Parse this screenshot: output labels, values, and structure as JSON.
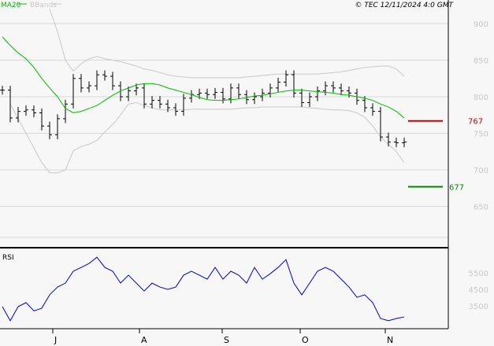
{
  "header": {
    "ma_label": "MA20",
    "bb_label": "BBands",
    "copyright": "© TEC 12/11/2024 4:0 GMT"
  },
  "colors": {
    "ma": "#00bb00",
    "bb": "#c8c8c8",
    "rsi": "#0000cc",
    "resistance": "#cc0000",
    "support": "#008800",
    "grid": "#d8d8d8"
  },
  "chart_data": [
    {
      "type": "ohlc",
      "title": "Price",
      "ylim": [
        620,
        930
      ],
      "yticks": [
        650,
        700,
        750,
        800,
        850,
        900
      ],
      "closes": [
        809,
        771,
        780,
        782,
        778,
        760,
        748,
        770,
        790,
        825,
        812,
        815,
        830,
        828,
        815,
        800,
        808,
        812,
        790,
        795,
        790,
        785,
        780,
        798,
        803,
        805,
        803,
        806,
        797,
        812,
        803,
        796,
        800,
        805,
        812,
        820,
        830,
        805,
        792,
        800,
        808,
        815,
        812,
        808,
        805,
        795,
        785,
        780,
        745,
        738,
        737,
        738
      ],
      "ma20": [
        882,
        870,
        860,
        852,
        840,
        825,
        812,
        800,
        784,
        778,
        780,
        784,
        788,
        795,
        802,
        808,
        812,
        816,
        818,
        818,
        816,
        812,
        809,
        806,
        803,
        799,
        796,
        795,
        795,
        796,
        797,
        799,
        801,
        802,
        804,
        806,
        808,
        809,
        809,
        808,
        807,
        806,
        805,
        803,
        802,
        800,
        798,
        795,
        790,
        786,
        780,
        771
      ],
      "bb_upper": [
        null,
        null,
        null,
        null,
        null,
        null,
        920,
        889,
        850,
        835,
        845,
        852,
        855,
        852,
        850,
        848,
        845,
        842,
        838,
        836,
        833,
        830,
        828,
        827,
        826,
        826,
        826,
        826,
        826,
        826,
        826,
        827,
        828,
        829,
        830,
        831,
        831,
        831,
        831,
        831,
        831,
        832,
        833,
        834,
        836,
        838,
        840,
        841,
        842,
        842,
        838,
        828
      ],
      "bb_lower": [
        null,
        790,
        770,
        750,
        730,
        710,
        696,
        696,
        700,
        726,
        732,
        735,
        740,
        752,
        762,
        775,
        790,
        792,
        788,
        785,
        782,
        782,
        782,
        782,
        783,
        783,
        783,
        783,
        783,
        783,
        784,
        785,
        785,
        786,
        786,
        786,
        786,
        786,
        786,
        785,
        784,
        783,
        782,
        782,
        781,
        778,
        772,
        760,
        745,
        735,
        725,
        710
      ],
      "levels": [
        {
          "label": "767",
          "value": 767,
          "kind": "resistance"
        },
        {
          "label": "677",
          "value": 677,
          "kind": "support"
        }
      ]
    },
    {
      "type": "line",
      "title": "RSI",
      "ylabel": "RSI",
      "yticks": [
        {
          "label": "5500",
          "value": 55
        },
        {
          "label": "4500",
          "value": 45
        },
        {
          "label": "3500",
          "value": 35
        }
      ],
      "ylim": [
        17,
        68
      ],
      "values": [
        34.5,
        26,
        34.5,
        37,
        32,
        33.6,
        41.7,
        46.4,
        48.8,
        56,
        58.3,
        60.7,
        64.5,
        58.3,
        56,
        48.8,
        53.6,
        48.8,
        44,
        48.8,
        46.4,
        45,
        46.4,
        53.6,
        56,
        53.6,
        51.2,
        58.3,
        51.2,
        56,
        53.6,
        48.8,
        58.3,
        51.2,
        54.5,
        58.3,
        63,
        48.8,
        41.7,
        48.8,
        56,
        58.3,
        56,
        51.2,
        46.4,
        40.2,
        41.7,
        37,
        27.4,
        26,
        27.4,
        28.3
      ]
    }
  ],
  "xaxis": {
    "labels": [
      "J",
      "A",
      "S",
      "O",
      "N"
    ],
    "label_index": [
      6.4,
      17.4,
      27.9,
      37.8,
      48.6
    ]
  }
}
